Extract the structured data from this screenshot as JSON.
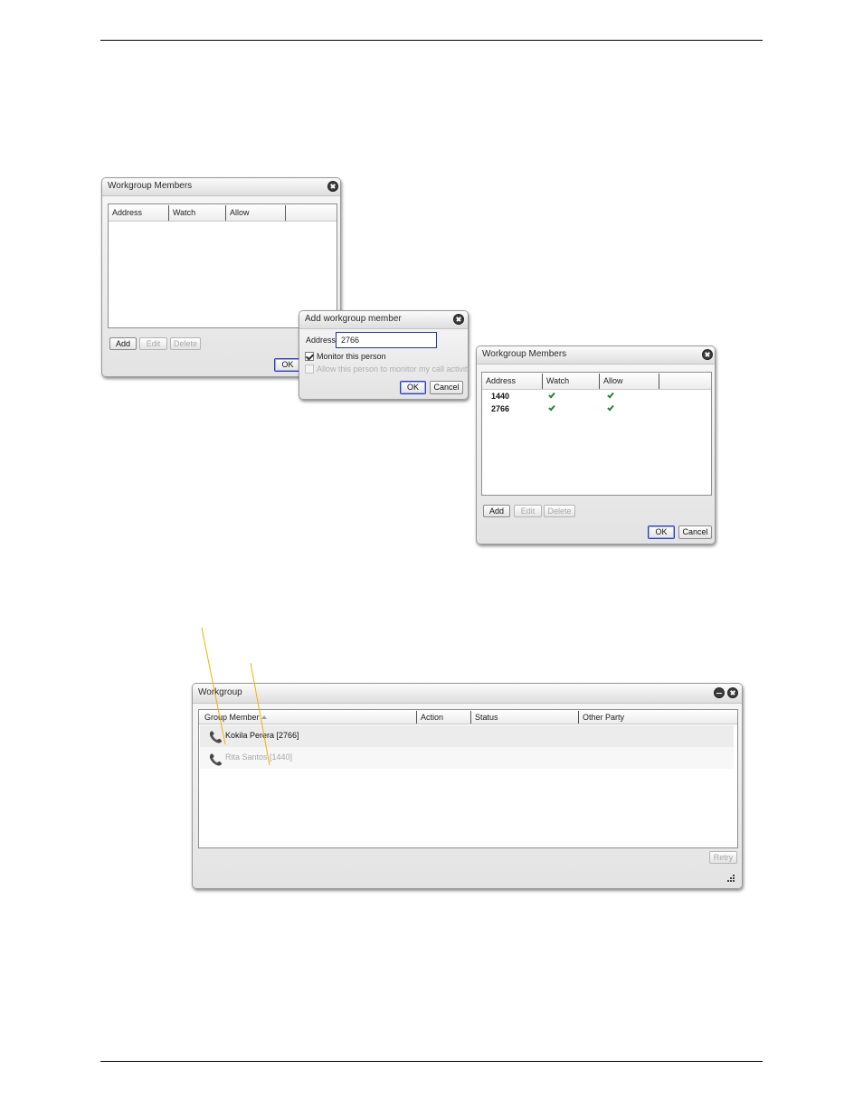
{
  "dialog_members_empty": {
    "title": "Workgroup Members",
    "columns": [
      "Address",
      "Watch",
      "Allow"
    ],
    "buttons": {
      "add": "Add",
      "edit": "Edit",
      "delete": "Delete",
      "ok": "OK"
    }
  },
  "dialog_add_member": {
    "title": "Add workgroup member",
    "address_label": "Address",
    "address_value": "2766",
    "monitor_label": "Monitor this person",
    "monitor_checked": true,
    "allow_label": "Allow this person to monitor my call activity",
    "allow_enabled": false,
    "buttons": {
      "ok": "OK",
      "cancel": "Cancel"
    }
  },
  "dialog_members_filled": {
    "title": "Workgroup Members",
    "columns": [
      "Address",
      "Watch",
      "Allow"
    ],
    "rows": [
      {
        "address": "1440",
        "watch": true,
        "allow": true
      },
      {
        "address": "2766",
        "watch": true,
        "allow": true
      }
    ],
    "buttons": {
      "add": "Add",
      "edit": "Edit",
      "delete": "Delete",
      "ok": "OK",
      "cancel": "Cancel"
    }
  },
  "workgroup": {
    "title": "Workgroup",
    "columns": [
      "Group Member",
      "Action",
      "Status",
      "Other Party"
    ],
    "sorted_column": "Group Member",
    "rows": [
      {
        "member": "Kokila Perera [2766]",
        "available": true
      },
      {
        "member": "Rita Santos [1440]",
        "available": false
      }
    ],
    "retry_label": "Retry"
  },
  "colors": {
    "callout_line": "#f0b400",
    "check_mark": "#1d8a3a",
    "default_button_border": "#2d3fb9"
  }
}
